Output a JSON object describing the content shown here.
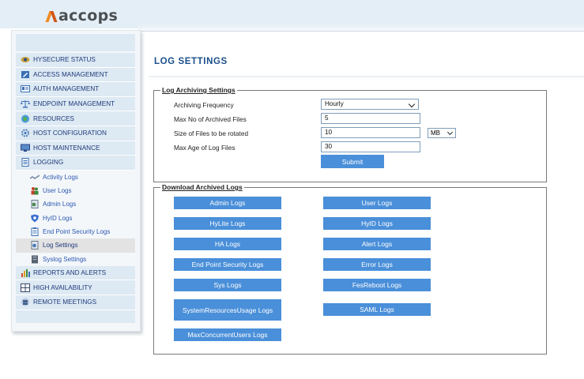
{
  "header": {
    "logo_text": "accops",
    "brand_colors": {
      "orange": "#f08a24",
      "dark": "#4b4f52"
    }
  },
  "sidebar": {
    "items": [
      {
        "label": "HYSECURE STATUS",
        "icon": "eye-icon"
      },
      {
        "label": "ACCESS MANAGEMENT",
        "icon": "edit-icon"
      },
      {
        "label": "AUTH MANAGEMENT",
        "icon": "id-card-icon"
      },
      {
        "label": "ENDPOINT MANAGEMENT",
        "icon": "scale-icon"
      },
      {
        "label": "RESOURCES",
        "icon": "globe-icon"
      },
      {
        "label": "HOST CONFIGURATION",
        "icon": "gear-icon"
      },
      {
        "label": "HOST MAINTENANCE",
        "icon": "monitor-icon"
      },
      {
        "label": "LOGGING",
        "icon": "document-icon"
      }
    ],
    "logging_subitems": [
      {
        "label": "Activity Logs",
        "icon": "activity-icon"
      },
      {
        "label": "User Logs",
        "icon": "users-icon"
      },
      {
        "label": "Admin Logs",
        "icon": "admin-icon"
      },
      {
        "label": "HyID Logs",
        "icon": "shield-icon"
      },
      {
        "label": "End Point Security Logs",
        "icon": "clipboard-icon"
      },
      {
        "label": "Log Settings",
        "icon": "settings-doc-icon",
        "active": true
      },
      {
        "label": "Syslog Settings",
        "icon": "server-icon"
      }
    ],
    "items_after": [
      {
        "label": "REPORTS AND ALERTS",
        "icon": "bar-chart-icon"
      },
      {
        "label": "HIGH AVAILABILITY",
        "icon": "grid-icon"
      },
      {
        "label": "REMOTE MEETINGS",
        "icon": "people-icon"
      }
    ]
  },
  "main": {
    "title": "LOG SETTINGS",
    "archiving": {
      "legend": "Log Archiving Settings",
      "frequency_label": "Archiving Frequency",
      "frequency_value": "Hourly",
      "max_files_label": "Max No of Archived Files",
      "max_files_value": "5",
      "size_label": "Size of Files to be rotated",
      "size_value": "10",
      "size_unit": "MB",
      "max_age_label": "Max Age of Log Files",
      "max_age_value": "30",
      "submit_label": "Submit"
    },
    "download": {
      "legend": "Download Archived Logs",
      "left_buttons": [
        "Admin Logs",
        "HyLite Logs",
        "HA Logs",
        "End Point Security Logs",
        "Sys Logs",
        "SystemResourcesUsage Logs",
        "MaxConcurrentUsers Logs"
      ],
      "right_buttons": [
        "User Logs",
        "HyID Logs",
        "Alert Logs",
        "Error Logs",
        "FesReboot Logs",
        "SAML Logs"
      ]
    }
  },
  "colors": {
    "button": "#4a8fd9",
    "nav_bg": "#dde9f3",
    "title": "#1a4f8b"
  }
}
